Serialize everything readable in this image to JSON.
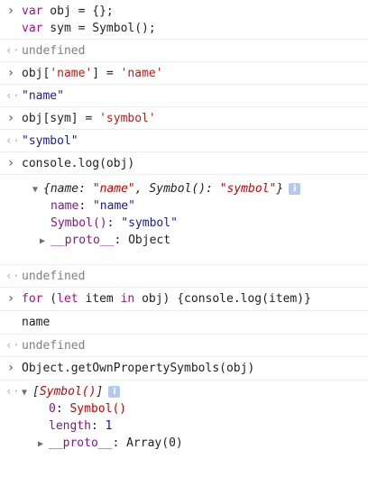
{
  "icons": {
    "prompt": "chevron-right-icon",
    "result": "return-arrow-icon",
    "expanded": "triangle-down-icon",
    "collapsed": "triangle-right-icon",
    "info": "info-icon"
  },
  "entry1": {
    "l1_kw": "var",
    "l1_rest": " obj = {};",
    "l2_kw": "var",
    "l2_rest": " sym = Symbol();"
  },
  "result1": "undefined",
  "entry2": {
    "a": "obj[",
    "b": "'name'",
    "c": "] = ",
    "d": "'name'"
  },
  "result2": "\"name\"",
  "entry3": {
    "a": "obj[sym] = ",
    "b": "'symbol'"
  },
  "result3": "\"symbol\"",
  "entry4": "console.log(obj)",
  "log1": {
    "preview_open": "{",
    "p1_key": "name",
    "p1_sep": ": ",
    "p1_val": "\"name\"",
    "comma": ", ",
    "p2_key": "Symbol()",
    "p2_sep": ": ",
    "p2_val": "\"symbol\"",
    "preview_close": "}",
    "info": "i",
    "row1_key": "name",
    "row1_sep": ": ",
    "row1_val": "\"name\"",
    "row2_key": "Symbol()",
    "row2_sep": ": ",
    "row2_val": "\"symbol\"",
    "row3_key": "__proto__",
    "row3_sep": ": ",
    "row3_val": "Object"
  },
  "result4": "undefined",
  "entry5": {
    "kw1": "for",
    "a": " (",
    "kw2": "let",
    "b": " item ",
    "kw3": "in",
    "c": " obj) {console.log(item)}"
  },
  "log2": "name",
  "result5": "undefined",
  "entry6": "Object.getOwnPropertySymbols(obj)",
  "result6": {
    "preview_open": "[",
    "preview_item": "Symbol()",
    "preview_close": "]",
    "info": "i",
    "row1_key": "0",
    "row1_sep": ": ",
    "row1_val": "Symbol()",
    "row2_key": "length",
    "row2_sep": ": ",
    "row2_val": "1",
    "row3_key": "__proto__",
    "row3_sep": ": ",
    "row3_val": "Array(0)"
  }
}
